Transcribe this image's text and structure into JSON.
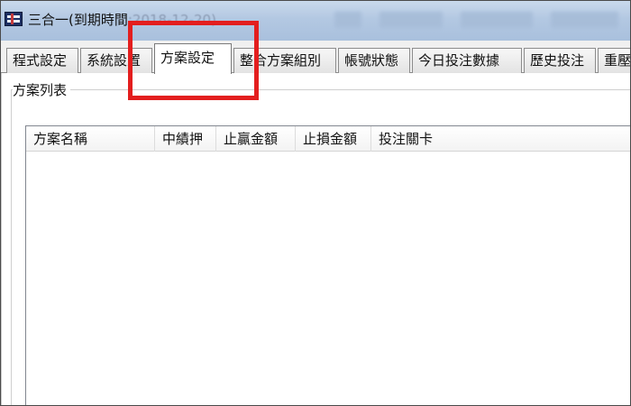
{
  "window": {
    "title": "三合一(到期時間",
    "expiry_date": ":2018-12-20)"
  },
  "tabs": [
    {
      "label": "程式設定"
    },
    {
      "label": "系統設置"
    },
    {
      "label": "方案設定",
      "active": true
    },
    {
      "label": "整合方案組別"
    },
    {
      "label": "帳號狀態"
    },
    {
      "label": "今日投注數據"
    },
    {
      "label": "歷史投注"
    },
    {
      "label": "重壓"
    }
  ],
  "group": {
    "label": "方案列表"
  },
  "plan_table": {
    "columns": [
      "方案名稱",
      "中績押",
      "止贏金額",
      "止損金額",
      "投注關卡"
    ],
    "rows": []
  },
  "annotation": {
    "color": "#e31e1e",
    "target": "tab-plan-settings"
  }
}
